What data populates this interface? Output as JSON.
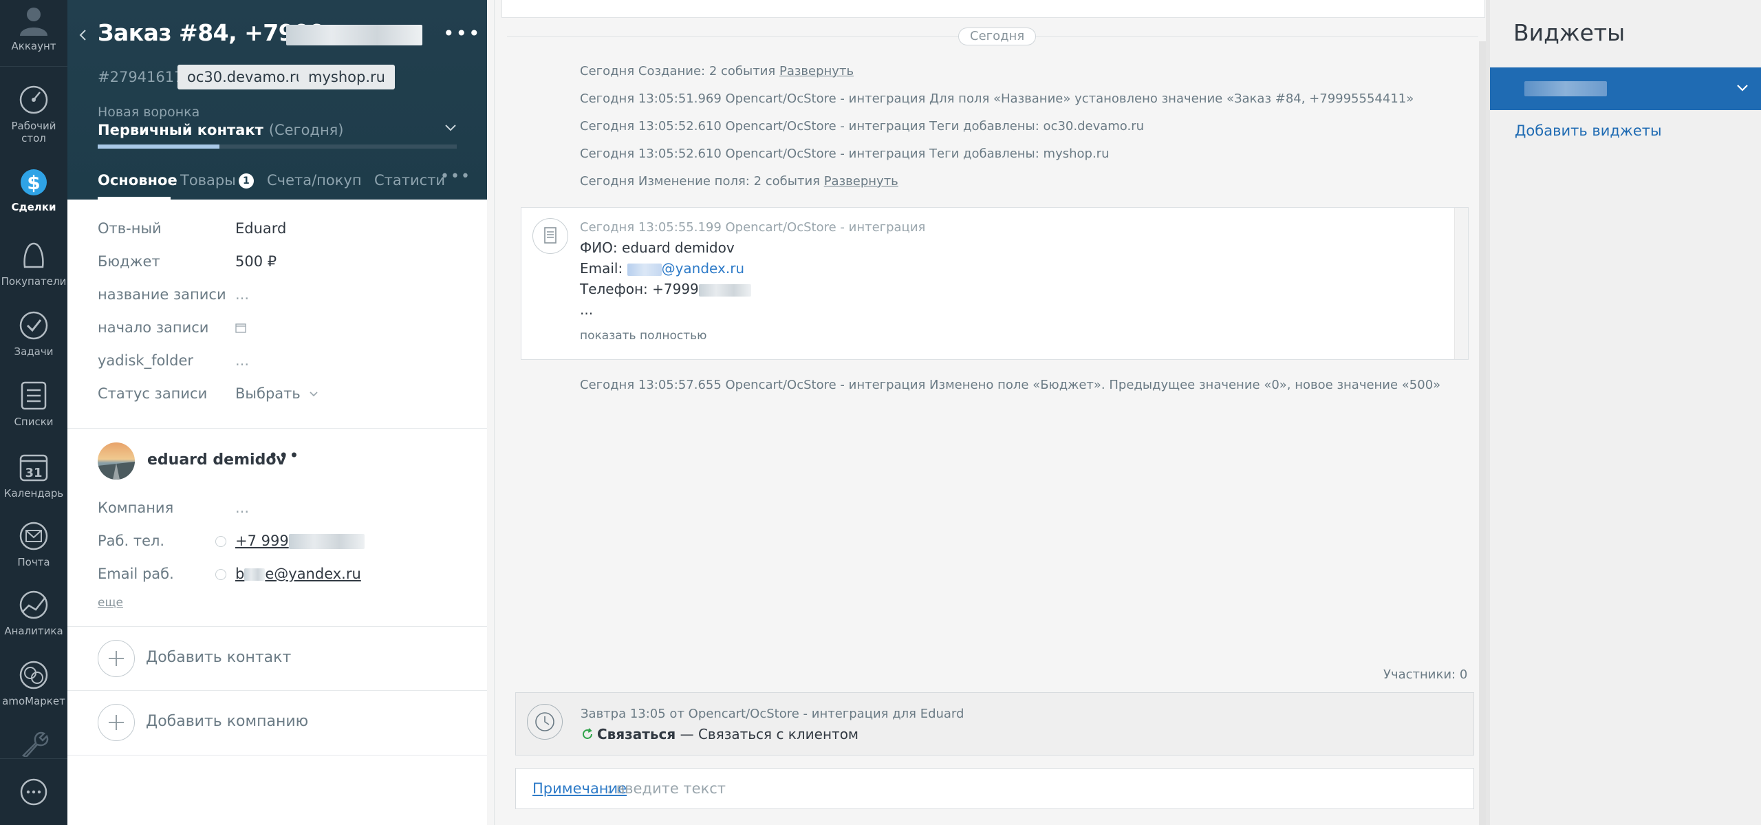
{
  "nav": {
    "items": [
      {
        "label": "Аккаунт",
        "icon": "account-icon"
      },
      {
        "label": "Рабочий стол",
        "icon": "dashboard-icon"
      },
      {
        "label": "Сделки",
        "icon": "deals-icon"
      },
      {
        "label": "Покупатели",
        "icon": "customers-icon"
      },
      {
        "label": "Задачи",
        "icon": "tasks-icon"
      },
      {
        "label": "Списки",
        "icon": "lists-icon"
      },
      {
        "label": "Календарь",
        "icon": "calendar-icon"
      },
      {
        "label": "Почта",
        "icon": "mail-icon"
      },
      {
        "label": "Аналитика",
        "icon": "analytics-icon"
      },
      {
        "label": "amoМаркет",
        "icon": "market-icon"
      }
    ],
    "calendar_day": "31"
  },
  "lead": {
    "title": "Заказ #84, +7999",
    "id": "#27941617",
    "tags": [
      "oc30.devamo.ru",
      "myshop.ru"
    ],
    "pipeline": "Новая воронка",
    "stage": "Первичный контакт",
    "stage_date": "(Сегодня)",
    "progress": 0.34,
    "tabs": {
      "main": "Основное",
      "goods": "Товары",
      "goods_count": "1",
      "invoices": "Счета/покуп",
      "stats": "Статисти"
    },
    "fields": [
      {
        "label": "Отв-ный",
        "value": "Eduard"
      },
      {
        "label": "Бюджет",
        "value": "500 ₽"
      },
      {
        "label": "название записи",
        "value": "..."
      },
      {
        "label": "начало записи",
        "value": ""
      },
      {
        "label": "yadisk_folder",
        "value": "..."
      },
      {
        "label": "Статус записи",
        "value": "Выбрать"
      }
    ]
  },
  "contact": {
    "name": "eduard demidov",
    "company_label": "Компания",
    "company_value": "...",
    "phone_label": "Раб. тел.",
    "phone_value": "+7 999",
    "email_label": "Email раб.",
    "email_prefix": "b",
    "email_suffix": "e@yandex.ru",
    "more": "еще",
    "add_contact": "Добавить контакт",
    "add_company": "Добавить компанию"
  },
  "feed": {
    "today_pill": "Сегодня",
    "events": [
      {
        "text": "Сегодня Создание: 2 события ",
        "link": "Развернуть"
      },
      {
        "text": "Сегодня 13:05:51.969 Opencart/OcStore - интеграция Для поля «Название» установлено значение «Заказ #84, +79995554411»",
        "link": ""
      },
      {
        "text": "Сегодня 13:05:52.610 Opencart/OcStore - интеграция Теги добавлены: oc30.devamo.ru",
        "link": ""
      },
      {
        "text": "Сегодня 13:05:52.610 Opencart/OcStore - интеграция Теги добавлены: myshop.ru",
        "link": ""
      },
      {
        "text": "Сегодня Изменение поля: 2 события ",
        "link": "Развернуть"
      }
    ],
    "note": {
      "meta": "Сегодня 13:05:55.199 Opencart/OcStore - интеграция",
      "fio": "ФИО: eduard demidov",
      "email_label": "Email: ",
      "email_value": "@yandex.ru",
      "phone": "Телефон: +7999",
      "ellipsis": "...",
      "show_full": "показать полностью"
    },
    "budget_event": "Сегодня 13:05:57.655 Opencart/OcStore - интеграция Изменено поле «Бюджет». Предыдущее значение «0», новое значение «500»",
    "participants": "Участники: 0",
    "task": {
      "meta": "Завтра 13:05 от Opencart/OcStore - интеграция для Eduard",
      "type": "Связаться",
      "text": " — Связаться с клиентом"
    },
    "note_input": {
      "link": "Примечание",
      "placeholder": ": введите текст"
    }
  },
  "widgets": {
    "title": "Виджеты",
    "add": "Добавить виджеты"
  },
  "colors": {
    "nav_bg": "#1c2b36",
    "header_bg": "#1f3f4f",
    "accent": "#1f6bb3",
    "link": "#2e7bc8"
  }
}
